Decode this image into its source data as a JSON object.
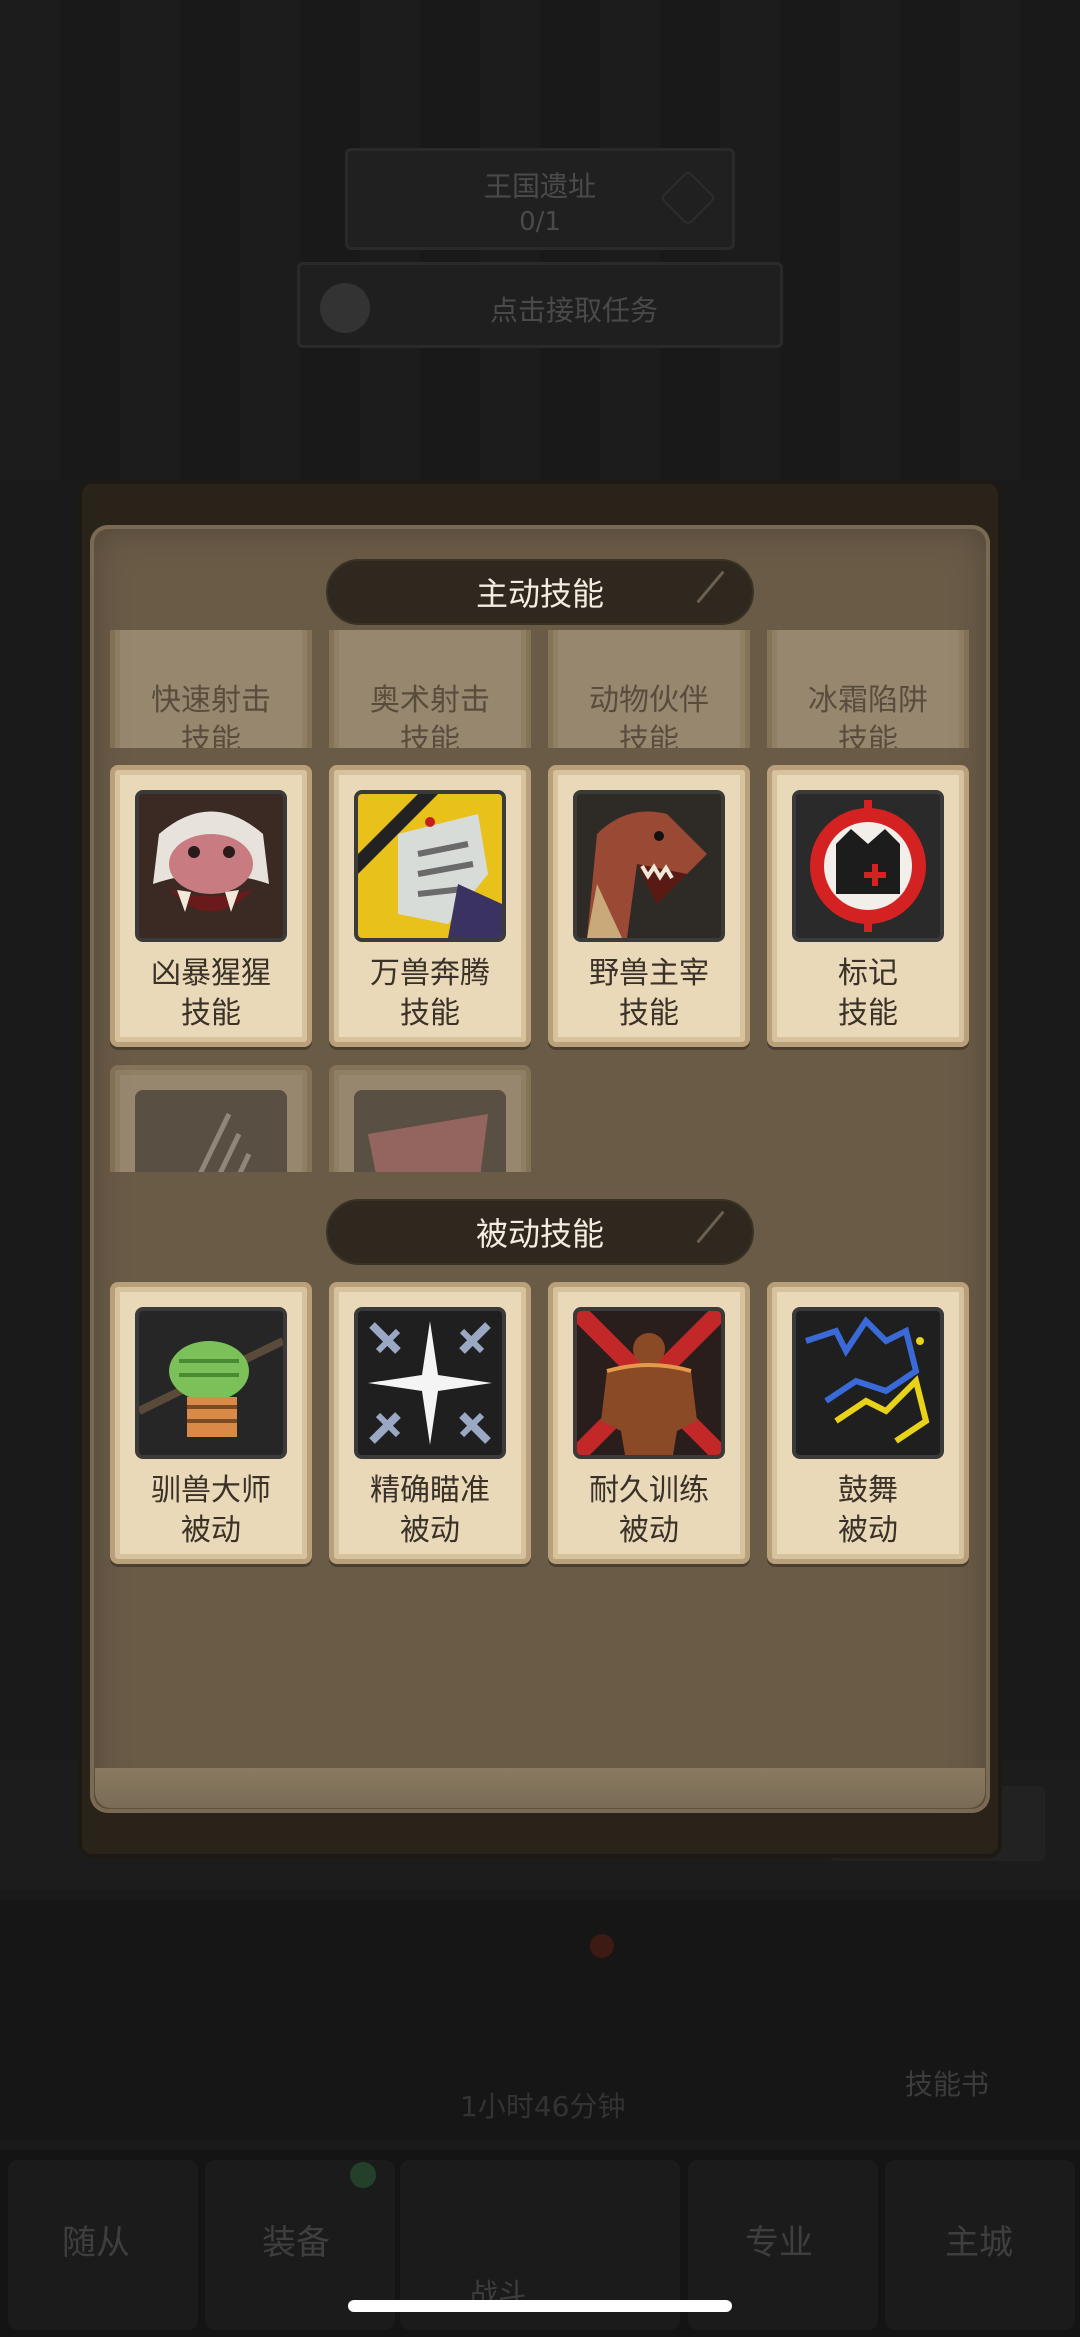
{
  "background": {
    "kingdom": {
      "title": "王国遗址",
      "progress": "0/1"
    },
    "task_button": "点击接取任务",
    "timer_text": "1小时46分钟",
    "skill_book_label": "技能书",
    "nav": [
      "随从",
      "装备",
      "战斗",
      "专业",
      "主城"
    ]
  },
  "modal": {
    "active_header": "主动技能",
    "passive_header": "被动技能",
    "active_partial_top": [
      {
        "name": "快速射击",
        "kind": "技能"
      },
      {
        "name": "奥术射击",
        "kind": "技能"
      },
      {
        "name": "动物伙伴",
        "kind": "技能"
      },
      {
        "name": "冰霜陷阱",
        "kind": "技能"
      }
    ],
    "active_skills": [
      {
        "name": "凶暴猩猩",
        "kind": "技能",
        "icon": "ape-icon"
      },
      {
        "name": "万兽奔腾",
        "kind": "技能",
        "icon": "beast-stampede-icon"
      },
      {
        "name": "野兽主宰",
        "kind": "技能",
        "icon": "raptor-icon"
      },
      {
        "name": "标记",
        "kind": "技能",
        "icon": "hunters-mark-icon"
      }
    ],
    "active_partial_bottom": [
      {
        "icon": "arrow-volley-icon"
      },
      {
        "icon": "pink-beast-icon"
      }
    ],
    "passive_skills": [
      {
        "name": "驯兽大师",
        "kind": "被动",
        "icon": "fist-icon"
      },
      {
        "name": "精确瞄准",
        "kind": "被动",
        "icon": "crosshair-icon"
      },
      {
        "name": "耐久训练",
        "kind": "被动",
        "icon": "strongman-icon"
      },
      {
        "name": "鼓舞",
        "kind": "被动",
        "icon": "inspire-icon"
      }
    ]
  },
  "colors": {
    "panel": "#6a5b47",
    "card": "#ead9b8",
    "header": "#2f281f"
  }
}
